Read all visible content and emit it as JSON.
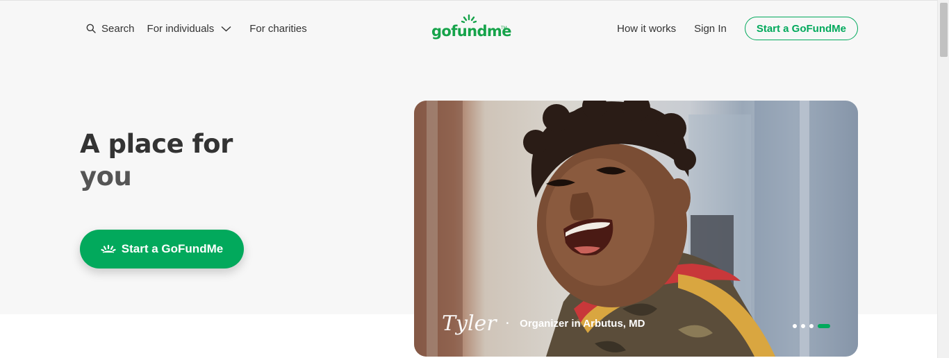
{
  "header": {
    "search_label": "Search",
    "for_individuals_label": "For individuals",
    "for_charities_label": "For charities",
    "logo_text": "gofundme",
    "logo_tm": "TM",
    "how_it_works_label": "How it works",
    "sign_in_label": "Sign In",
    "start_button_label": "Start a GoFundMe"
  },
  "hero": {
    "title_line1": "A place for",
    "title_line2": "you",
    "cta_label": "Start a GoFundMe"
  },
  "photo": {
    "signature": "Tyler",
    "separator": "•",
    "organizer_text": "Organizer in Arbutus, MD",
    "carousel_slides": 4,
    "active_slide": 4
  },
  "colors": {
    "brand_green": "#02a95c",
    "background": "#f7f7f7",
    "text": "#333333"
  },
  "icons": {
    "search": "search-icon",
    "chevron": "chevron-down-icon",
    "logo_sun": "sun-rays-icon"
  }
}
